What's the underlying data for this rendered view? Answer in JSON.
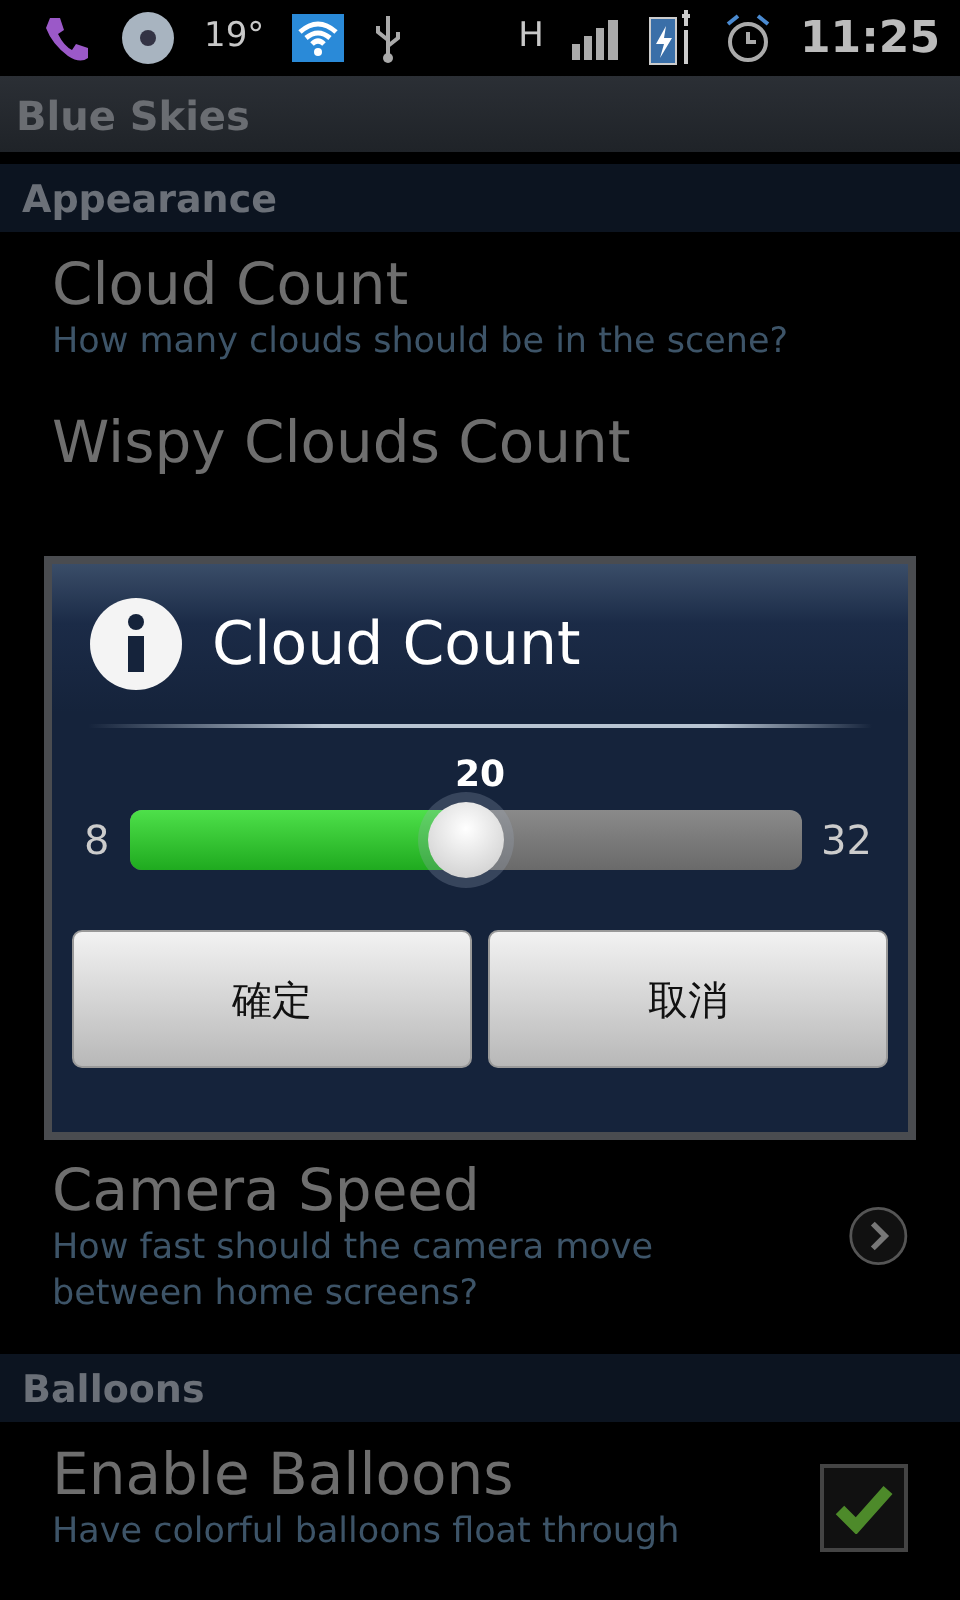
{
  "status_bar": {
    "temperature": "19°",
    "network_type": "H",
    "time": "11:25"
  },
  "title": "Blue Skies",
  "settings_top": [
    {
      "kind": "header",
      "text": "Appearance"
    },
    {
      "kind": "plain_item",
      "title": "Cloud Count",
      "summary": "How many clouds should be in the scene?"
    },
    {
      "kind": "plain_item",
      "title": "Wispy Clouds Count"
    }
  ],
  "settings_bottom": [
    {
      "kind": "chevron_item",
      "title": "Camera Speed",
      "summary": "How fast should the camera move between home screens?"
    },
    {
      "kind": "header",
      "text": "Balloons"
    },
    {
      "kind": "checkbox_item",
      "title": "Enable Balloons",
      "summary": "Have colorful balloons float through",
      "checked": true
    }
  ],
  "dialog": {
    "title": "Cloud Count",
    "value": "20",
    "min": "8",
    "max": "32",
    "level": 0.5,
    "buttons": [
      "確定",
      "取消"
    ]
  }
}
